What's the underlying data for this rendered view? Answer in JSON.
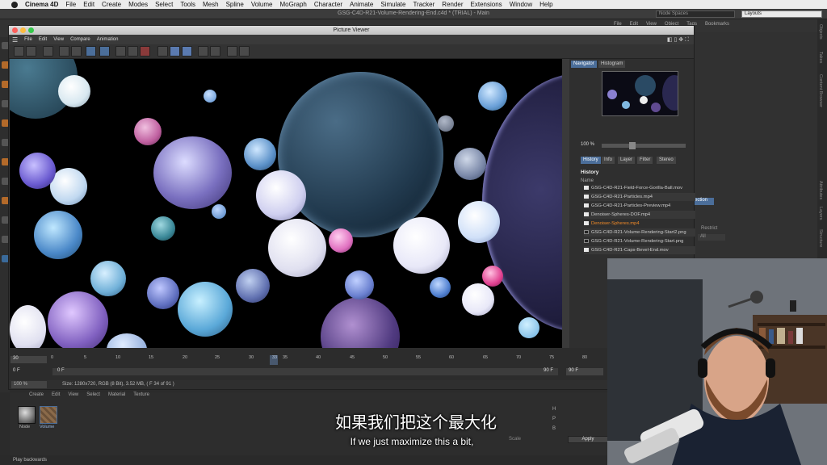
{
  "mac_menu": {
    "app": "Cinema 4D",
    "items": [
      "File",
      "Edit",
      "Create",
      "Modes",
      "Select",
      "Tools",
      "Mesh",
      "Spline",
      "Volume",
      "MoGraph",
      "Character",
      "Animate",
      "Simulate",
      "Tracker",
      "Render",
      "Extensions",
      "Window",
      "Help"
    ]
  },
  "window_title": "GSG-C4D-R21-Volume-Rendering-End.c4d * (TRIAL) - Main",
  "node_spaces": "Node Spaces",
  "layouts": "Layouts",
  "bg_menu": [
    "File",
    "Edit",
    "View",
    "Object",
    "Tags",
    "Bookmarks"
  ],
  "right_tabs": [
    "Objects",
    "Takes",
    "Content Browser",
    "Attributes",
    "Layers",
    "Structure"
  ],
  "picture_viewer": {
    "title": "Picture Viewer",
    "menu": [
      "File",
      "Edit",
      "View",
      "Compare",
      "Animation"
    ],
    "panel_tabs_top": [
      "Navigator",
      "Histogram"
    ],
    "zoom": "100 %",
    "panel_tabs_mid": [
      "History",
      "Info",
      "Layer",
      "Filter",
      "Stereo"
    ],
    "history_title": "History",
    "name_col": "Name",
    "history_items": [
      {
        "label": "GSG-C4D-R21-Field-Force-Gorilla-Ball.mov",
        "highlight": false
      },
      {
        "label": "GSG-C4D-R21-Particles.mp4",
        "highlight": false
      },
      {
        "label": "GSG-C4D-R21-Particles-Preview.mp4",
        "highlight": false
      },
      {
        "label": "Denoiser-Spheres-DOF.mp4",
        "highlight": false
      },
      {
        "label": "Denoiser-Spheres.mp4",
        "highlight": true
      },
      {
        "label": "GSG-C4D-R21-Volume-Rendering-Start2.png",
        "highlight": false
      },
      {
        "label": "GSG-C4D-R21-Volume-Rendering-Start.png",
        "highlight": false
      },
      {
        "label": "GSG-C4D-R21-Caps-Bevel-End.mov",
        "highlight": false
      }
    ]
  },
  "timeline": {
    "frame": "30",
    "ticks": [
      "0",
      "5",
      "10",
      "15",
      "20",
      "25",
      "30",
      "33",
      "35",
      "40",
      "45",
      "50",
      "55",
      "60",
      "65",
      "70",
      "75",
      "80"
    ],
    "current": "0 F",
    "start": "0 F",
    "end1": "90 F",
    "end2": "90 F",
    "zoom": "100 %",
    "status": "Size: 1280x720, RGB (8 Bit), 3.52 MB,  ( F 34 of 91 )"
  },
  "materials": {
    "menu": [
      "Create",
      "Edit",
      "View",
      "Select",
      "Material",
      "Texture"
    ],
    "items": [
      "Node",
      "Volume"
    ]
  },
  "coords": {
    "labels": [
      "H",
      "P",
      "B"
    ],
    "scale": "Scale",
    "apply": "Apply"
  },
  "bg_attr": {
    "section": "ection",
    "restrict": "Restrict",
    "all": "All"
  },
  "status_bar": "Play backwards",
  "subtitle_cn": "如果我们把这个最大化",
  "subtitle_en": "If we just maximize this a bit,"
}
